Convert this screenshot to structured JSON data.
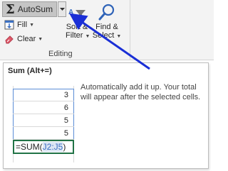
{
  "ribbon": {
    "autosum_label": "AutoSum",
    "fill_label": "Fill",
    "clear_label": "Clear",
    "sort_line1": "Sort &",
    "sort_line2": "Filter",
    "find_line1": "Find &",
    "find_line2": "Select",
    "group_label": "Editing"
  },
  "tooltip": {
    "title": "Sum (Alt+=)",
    "description": "Automatically add it up. Your total will appear after the selected cells.",
    "cells": [
      "3",
      "6",
      "5",
      "5"
    ],
    "formula_prefix": "=SUM(",
    "formula_ref": "J2:J5",
    "formula_suffix": ")"
  },
  "colors": {
    "accent_blue": "#1a2fd6",
    "selection_blue": "#5b8dd6",
    "active_cell_green": "#217346"
  },
  "icons": [
    "sigma-icon",
    "fill-down-icon",
    "eraser-icon",
    "sort-filter-icon",
    "magnifier-icon",
    "caret-down-icon",
    "pointer-arrow"
  ]
}
